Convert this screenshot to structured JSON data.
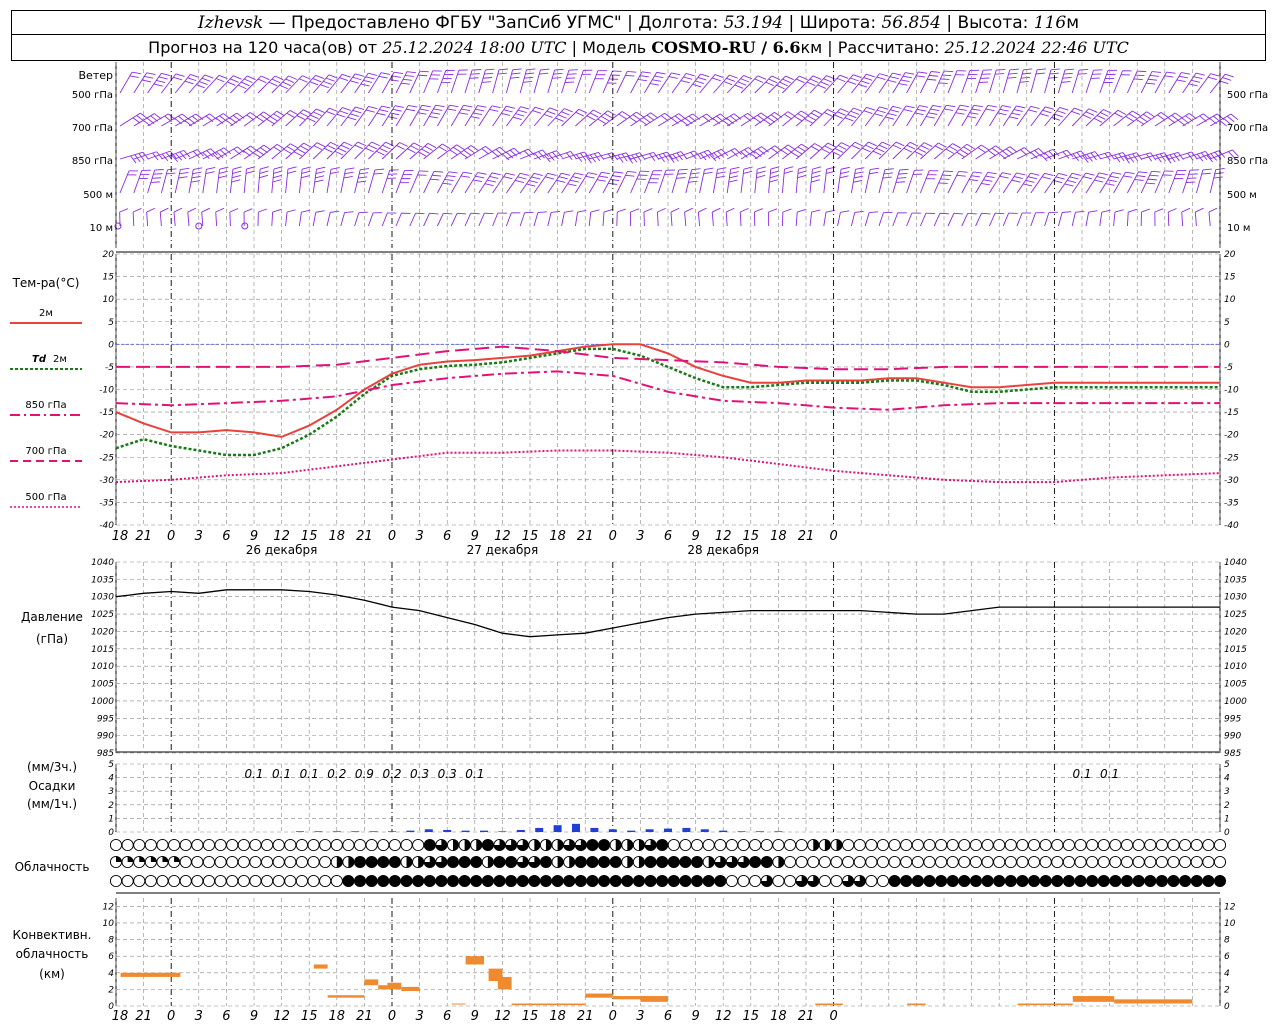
{
  "header": {
    "line1": {
      "city": "Izhevsk",
      "provider": " — Предоставлено ФГБУ \"ЗапСиб УГМС\" | Долгота: ",
      "lon": "53.194",
      "lat_label": " | Широта: ",
      "lat": "56.854",
      "alt_label": " | Высота: ",
      "alt": "116",
      "alt_unit": "м"
    },
    "line2": {
      "forecast": "Прогноз на 120 часа(ов) от ",
      "run": "25.12.2024 18:00 UTC",
      "model_label": " | Модель ",
      "model": "COSMO-RU / 6.6",
      "model_unit": "км",
      "calc_label": " | Рассчитано: ",
      "calc": "25.12.2024 22:46 UTC"
    }
  },
  "wind": {
    "title": "Ветер",
    "levels": [
      "500 гПа",
      "700 гПа",
      "850 гПа",
      "500 м",
      "10  м"
    ],
    "levels_right": [
      "500 гПа",
      "700 гПа",
      "850 гПа",
      "500 м",
      "10  м"
    ],
    "color": "#8a2be2"
  },
  "time_axis": {
    "hours": [
      "18",
      "21",
      "0",
      "3",
      "6",
      "9",
      "12",
      "15",
      "18",
      "21",
      "0",
      "3",
      "6",
      "9",
      "12",
      "15",
      "18",
      "21",
      "0",
      "3",
      "6",
      "9",
      "12",
      "15",
      "18",
      "21",
      "0"
    ],
    "days": [
      "26 декабря",
      "27 декабря",
      "28 декабря"
    ]
  },
  "temperature": {
    "title": "Тем-ра(°C)",
    "legend": [
      {
        "label": "2м",
        "color": "#e8423c",
        "style": "solid"
      },
      {
        "label": "Td  2м",
        "label_td": "Td",
        "color": "#1a7a1a",
        "style": "dotted"
      },
      {
        "label": "850 гПа",
        "color": "#e0127a",
        "style": "dashdot"
      },
      {
        "label": "700 гПа",
        "color": "#e0127a",
        "style": "dashed"
      },
      {
        "label": "500 гПа",
        "color": "#e0127a",
        "style": "dotted"
      }
    ],
    "yticks": [
      "20",
      "15",
      "10",
      "5",
      "0",
      "-5",
      "-10",
      "-15",
      "-20",
      "-25",
      "-30",
      "-35",
      "-40"
    ]
  },
  "pressure": {
    "title": "Давление",
    "unit": "(гПа)",
    "yticks": [
      "1040",
      "1035",
      "1030",
      "1025",
      "1020",
      "1015",
      "1010",
      "1005",
      "1000",
      "995",
      "990",
      "985"
    ]
  },
  "precip": {
    "unit3": "(мм/3ч.)",
    "title": "Осадки",
    "unit1": "(мм/1ч.)",
    "yticks": [
      "5",
      "4",
      "3",
      "2",
      "1",
      "0"
    ],
    "totals": [
      {
        "h": 15,
        "v": "0.1"
      },
      {
        "h": 18,
        "v": "0.1"
      },
      {
        "h": 21,
        "v": "0.1"
      },
      {
        "h": 24,
        "v": "0.2"
      },
      {
        "h": 27,
        "v": "0.9"
      },
      {
        "h": 30,
        "v": "0.2"
      },
      {
        "h": 33,
        "v": "0.3"
      },
      {
        "h": 36,
        "v": "0.3"
      },
      {
        "h": 39,
        "v": "0.1"
      },
      {
        "h": 105,
        "v": "0.1"
      },
      {
        "h": 108,
        "v": "0.1"
      }
    ],
    "color": "#1f3fd6"
  },
  "clouds": {
    "title": "Облачность"
  },
  "convective": {
    "title1": "Конвективн.",
    "title2": "облачность",
    "unit": "(км)",
    "yticks": [
      "12",
      "10",
      "8",
      "6",
      "4",
      "2",
      "0"
    ],
    "color": "#f08a30"
  },
  "chart_data": [
    {
      "type": "line",
      "title": "Тем-ра(°C)",
      "x_unit": "hours since 25.12.2024 18:00 UTC",
      "ylim": [
        -40,
        20
      ],
      "series": [
        {
          "name": "2м",
          "x": [
            0,
            3,
            6,
            9,
            12,
            15,
            18,
            21,
            24,
            27,
            30,
            33,
            36,
            39,
            42,
            45,
            48,
            51,
            54,
            57,
            60,
            63,
            66,
            69,
            72,
            75,
            78,
            81,
            84,
            87,
            90,
            93,
            96,
            99,
            102,
            105,
            108,
            111,
            114,
            117,
            120
          ],
          "values": [
            -15,
            -17.5,
            -19.5,
            -19.5,
            -19,
            -19.5,
            -20.5,
            -18,
            -14.5,
            -10,
            -6.5,
            -4.5,
            -3.8,
            -3.5,
            -3,
            -2.5,
            -1.5,
            -0.5,
            0,
            0,
            -2,
            -5,
            -7,
            -8.5,
            -8.5,
            -8,
            -8,
            -8,
            -7.5,
            -7.5,
            -8.5,
            -9.5,
            -9.5,
            -9,
            -8.5,
            -8.5,
            -8.5,
            -8.5,
            -8.5,
            -8.5,
            -8.5
          ]
        },
        {
          "name": "Td  2м",
          "x": [
            0,
            3,
            6,
            9,
            12,
            15,
            18,
            21,
            24,
            27,
            30,
            33,
            36,
            39,
            42,
            45,
            48,
            51,
            54,
            57,
            60,
            63,
            66,
            69,
            72,
            75,
            78,
            81,
            84,
            87,
            90,
            93,
            96,
            99,
            102,
            105,
            108,
            111,
            114,
            117,
            120
          ],
          "values": [
            -23,
            -21,
            -22.5,
            -23.5,
            -24.5,
            -24.5,
            -23,
            -20,
            -16,
            -11,
            -7,
            -5.5,
            -4.8,
            -4.5,
            -4,
            -3,
            -2,
            -1,
            -1,
            -2.5,
            -5,
            -7.5,
            -9.5,
            -9.5,
            -9,
            -8.5,
            -8.5,
            -8.5,
            -8,
            -8,
            -9,
            -10.5,
            -10.5,
            -10,
            -9.5,
            -9.5,
            -9.5,
            -9.5,
            -9.5,
            -9.5,
            -9.5
          ]
        },
        {
          "name": "850 гПа",
          "x": [
            0,
            6,
            12,
            18,
            24,
            30,
            36,
            42,
            48,
            54,
            60,
            66,
            72,
            78,
            84,
            90,
            96,
            102,
            108,
            114,
            120
          ],
          "values": [
            -13,
            -13.5,
            -13,
            -12.5,
            -11.5,
            -9,
            -7.5,
            -6.5,
            -6,
            -7,
            -10.5,
            -12.5,
            -13,
            -14,
            -14.5,
            -13.5,
            -13,
            -13,
            -13,
            -13,
            -13
          ]
        },
        {
          "name": "700 гПа",
          "x": [
            0,
            6,
            12,
            18,
            24,
            30,
            36,
            42,
            48,
            54,
            60,
            66,
            72,
            78,
            84,
            90,
            96,
            102,
            108,
            114,
            120
          ],
          "values": [
            -5,
            -5,
            -5,
            -5,
            -4.5,
            -3,
            -1.5,
            -0.5,
            -1.5,
            -3,
            -3.5,
            -4,
            -5,
            -5.5,
            -5.5,
            -5,
            -5,
            -5,
            -5,
            -5,
            -5
          ]
        },
        {
          "name": "500 гПа",
          "x": [
            0,
            6,
            12,
            18,
            24,
            30,
            36,
            42,
            48,
            54,
            60,
            66,
            72,
            78,
            84,
            90,
            96,
            102,
            108,
            114,
            120
          ],
          "values": [
            -30.5,
            -30,
            -29,
            -28.5,
            -27,
            -25.5,
            -24,
            -24,
            -23.5,
            -23.5,
            -24,
            -25,
            -26.5,
            -28,
            -29,
            -30,
            -30.5,
            -30.5,
            -29.5,
            -29,
            -28.5
          ]
        }
      ]
    },
    {
      "type": "line",
      "title": "Давление",
      "ylabel": "(гПа)",
      "x_unit": "hours since 25.12.2024 18:00 UTC",
      "ylim": [
        985,
        1040
      ],
      "series": [
        {
          "name": "",
          "x": [
            0,
            3,
            6,
            9,
            12,
            15,
            18,
            21,
            24,
            27,
            30,
            33,
            36,
            39,
            42,
            45,
            48,
            51,
            54,
            57,
            60,
            63,
            66,
            69,
            72,
            75,
            78,
            81,
            84,
            87,
            90,
            93,
            96,
            99,
            102,
            105,
            108,
            111,
            114,
            117,
            120
          ],
          "values": [
            1030,
            1031,
            1031.5,
            1031,
            1032,
            1032,
            1032,
            1031.5,
            1030.5,
            1029,
            1027,
            1026,
            1024,
            1022,
            1019.5,
            1018.5,
            1019,
            1019.5,
            1021,
            1022.5,
            1024,
            1025,
            1025.5,
            1026,
            1026,
            1026,
            1026,
            1026,
            1025.5,
            1025,
            1025,
            1026,
            1027,
            1027,
            1027,
            1027,
            1027,
            1027,
            1027,
            1027,
            1027
          ]
        }
      ]
    },
    {
      "type": "bar",
      "title": "Осадки",
      "ylabel": "(мм/1ч.)",
      "x_unit": "hours since 25.12.2024 18:00 UTC",
      "ylim": [
        0,
        5
      ],
      "x": [
        20,
        22,
        24,
        26,
        28,
        30,
        32,
        34,
        36,
        38,
        40,
        42,
        44,
        46,
        48,
        50,
        52,
        54,
        56,
        58,
        60,
        62,
        64,
        66,
        68,
        70,
        72
      ],
      "values": [
        0.05,
        0.05,
        0.05,
        0.05,
        0.05,
        0.05,
        0.1,
        0.2,
        0.15,
        0.1,
        0.1,
        0.05,
        0.15,
        0.3,
        0.5,
        0.6,
        0.3,
        0.2,
        0.1,
        0.2,
        0.25,
        0.3,
        0.2,
        0.1,
        0.05,
        0.05,
        0.05
      ]
    },
    {
      "type": "bar",
      "title": "Конвективн. облачность",
      "ylabel": "(км)",
      "x_unit": "hours since 25.12.2024 18:00 UTC",
      "ylim": [
        0,
        13
      ],
      "segments": [
        {
          "x0": 0.5,
          "x1": 7,
          "base": 3.5,
          "top": 4
        },
        {
          "x0": 21.5,
          "x1": 23,
          "base": 4.5,
          "top": 5
        },
        {
          "x0": 23,
          "x1": 25,
          "base": 1,
          "top": 1.3
        },
        {
          "x0": 25,
          "x1": 27,
          "base": 1,
          "top": 1.3
        },
        {
          "x0": 27,
          "x1": 28.5,
          "base": 2.5,
          "top": 3.2
        },
        {
          "x0": 28.5,
          "x1": 29.5,
          "base": 2,
          "top": 2.5
        },
        {
          "x0": 29.5,
          "x1": 31,
          "base": 2,
          "top": 2.8
        },
        {
          "x0": 31,
          "x1": 33,
          "base": 1.8,
          "top": 2.3
        },
        {
          "x0": 36.5,
          "x1": 38,
          "base": 0.2,
          "top": 0.3
        },
        {
          "x0": 38,
          "x1": 40,
          "base": 5,
          "top": 6
        },
        {
          "x0": 40.5,
          "x1": 42,
          "base": 3,
          "top": 4.5
        },
        {
          "x0": 41.5,
          "x1": 43,
          "base": 2,
          "top": 3.5
        },
        {
          "x0": 43,
          "x1": 51,
          "base": 0.1,
          "top": 0.3
        },
        {
          "x0": 51,
          "x1": 54,
          "base": 1,
          "top": 1.5
        },
        {
          "x0": 54,
          "x1": 57,
          "base": 0.8,
          "top": 1.2
        },
        {
          "x0": 57,
          "x1": 60,
          "base": 0.5,
          "top": 1.2
        },
        {
          "x0": 76,
          "x1": 79,
          "base": 0.1,
          "top": 0.3
        },
        {
          "x0": 86,
          "x1": 88,
          "base": 0.1,
          "top": 0.3
        },
        {
          "x0": 98,
          "x1": 104,
          "base": 0.1,
          "top": 0.3
        },
        {
          "x0": 104,
          "x1": 108.5,
          "base": 0.5,
          "top": 1.2
        },
        {
          "x0": 108.5,
          "x1": 117,
          "base": 0.3,
          "top": 0.8
        }
      ]
    }
  ]
}
